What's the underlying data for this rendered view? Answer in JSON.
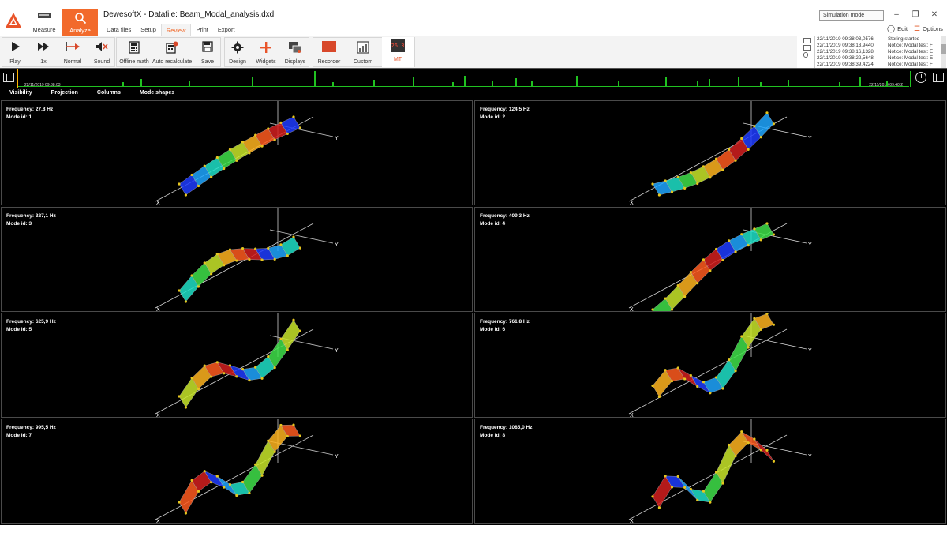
{
  "app": {
    "title": "DewesoftX - Datafile: Beam_Modal_analysis.dxd",
    "modes": [
      {
        "label": "Measure",
        "active": false
      },
      {
        "label": "Analyze",
        "active": true
      }
    ],
    "menu_tabs": [
      {
        "label": "Data files",
        "active": false
      },
      {
        "label": "Setup",
        "active": false
      },
      {
        "label": "Review",
        "active": true
      },
      {
        "label": "Print",
        "active": false
      },
      {
        "label": "Export",
        "active": false
      }
    ],
    "simulation_mode": "Simulation mode",
    "edit_label": "Edit",
    "options_label": "Options",
    "accent_color": "#f26a2b"
  },
  "toolbar": {
    "play": "Play",
    "speed": "1x",
    "normal": "Normal",
    "sound": "Sound",
    "offline_math": "Offline math",
    "auto_recalculate": "Auto recalculate",
    "save": "Save",
    "design": "Design",
    "widgets": "Widgets",
    "displays": "Displays",
    "recorder": "Recorder",
    "custom": "Custom",
    "mt": "MT",
    "mt_display": "26.3"
  },
  "notices": [
    {
      "time": "22/11/2019 09:38:03,0576",
      "message": "Storing started"
    },
    {
      "time": "22/11/2019 09:38:13,9440",
      "message": "Notice: Modal test: F"
    },
    {
      "time": "22/11/2019 09:38:16,1328",
      "message": "Notice: Modal test: E"
    },
    {
      "time": "22/11/2019 09:38:22,5648",
      "message": "Notice: Modal test: E"
    },
    {
      "time": "22/11/2019 09:38:39,4224",
      "message": "Notice: Modal test: F"
    }
  ],
  "overview": {
    "start_time": "22/11/2019 09:38:03",
    "end_time": "22/11/2019 09:40:2",
    "signal_color": "#21c121",
    "cursor_color": "#ffb400"
  },
  "visual_tabs": [
    "Visibility",
    "Projection",
    "Columns",
    "Mode shapes"
  ],
  "mode_shapes": [
    {
      "frequency": "Frequency: 27,8 Hz",
      "mode_id": "Mode id: 1"
    },
    {
      "frequency": "Frequency: 124,5 Hz",
      "mode_id": "Mode id: 2"
    },
    {
      "frequency": "Frequency: 327,1 Hz",
      "mode_id": "Mode id: 3"
    },
    {
      "frequency": "Frequency: 409,3 Hz",
      "mode_id": "Mode id: 4"
    },
    {
      "frequency": "Frequency: 625,9 Hz",
      "mode_id": "Mode id: 5"
    },
    {
      "frequency": "Frequency: 761,8 Hz",
      "mode_id": "Mode id: 6"
    },
    {
      "frequency": "Frequency: 995,5 Hz",
      "mode_id": "Mode id: 7"
    },
    {
      "frequency": "Frequency: 1085,0 Hz",
      "mode_id": "Mode id: 8"
    }
  ],
  "axes": {
    "x": "X",
    "y": "Y"
  }
}
